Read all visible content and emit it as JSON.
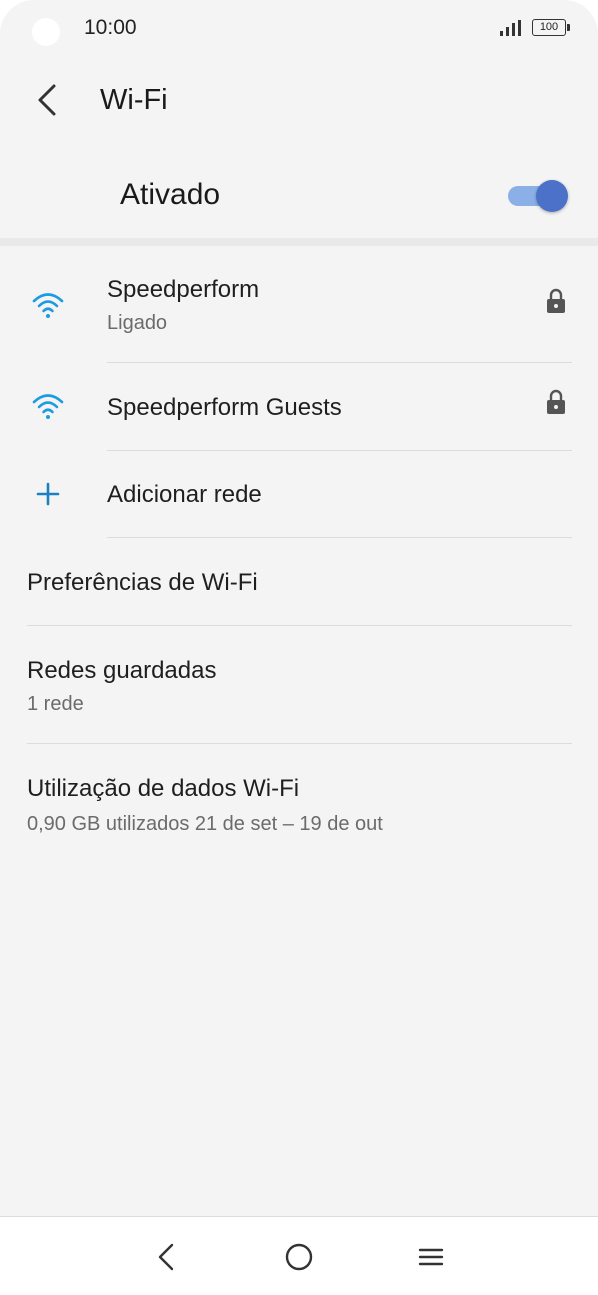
{
  "status_bar": {
    "time": "10:00",
    "battery": "100"
  },
  "app_bar": {
    "title": "Wi-Fi"
  },
  "master_switch": {
    "label": "Ativado",
    "on": true,
    "accent": "#4b72c8"
  },
  "networks": [
    {
      "name": "Speedperform",
      "status": "Ligado",
      "secured": true,
      "icon": "wifi-icon"
    },
    {
      "name": "Speedperform Guests",
      "secured": true,
      "icon": "wifi-icon"
    }
  ],
  "add_network": {
    "label": "Adicionar rede",
    "icon": "plus-icon"
  },
  "preferences": {
    "label": "Preferências de Wi-Fi"
  },
  "saved_networks": {
    "label": "Redes guardadas",
    "summary": "1 rede"
  },
  "data_usage": {
    "label": "Utilização de dados Wi-Fi",
    "summary": "0,90 GB utilizados 21 de set – 19 de out"
  },
  "colors": {
    "wifi": "#1b9be0",
    "accent": "#4b72c8"
  }
}
